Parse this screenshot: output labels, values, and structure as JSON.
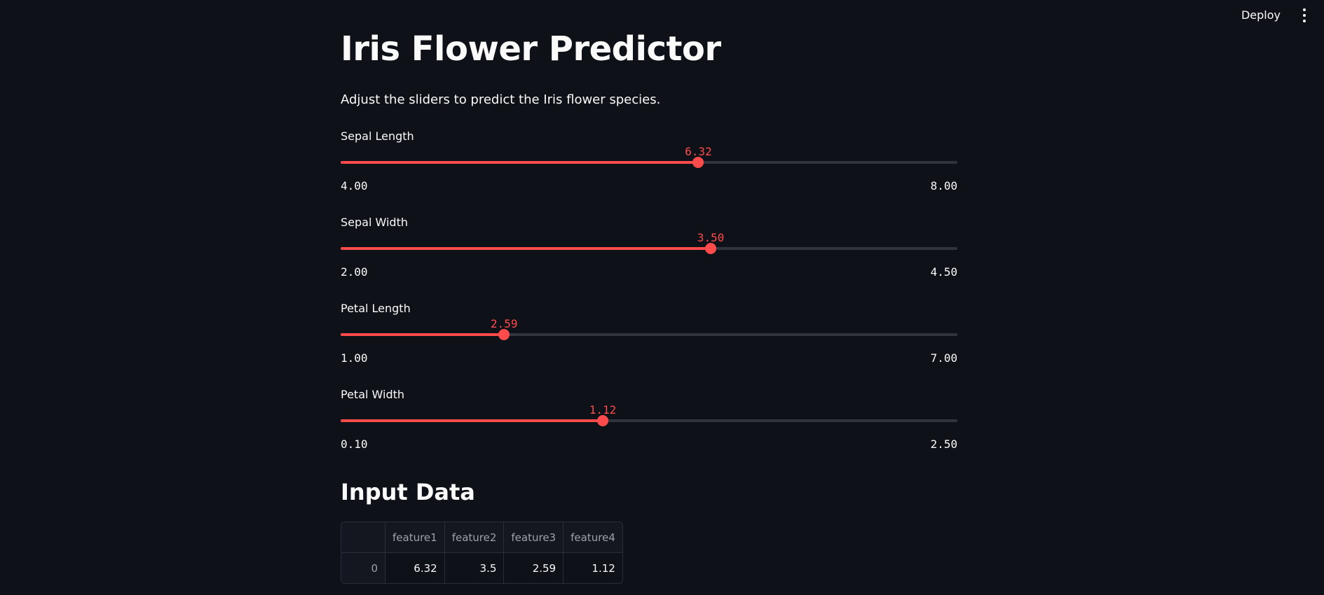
{
  "header": {
    "deploy_label": "Deploy",
    "menu_icon": "kebab-menu-icon"
  },
  "page": {
    "title": "Iris Flower Predictor",
    "subtitle": "Adjust the sliders to predict the Iris flower species."
  },
  "sliders": [
    {
      "label": "Sepal Length",
      "value": "6.32",
      "min": "4.00",
      "max": "8.00"
    },
    {
      "label": "Sepal Width",
      "value": "3.50",
      "min": "2.00",
      "max": "4.50"
    },
    {
      "label": "Petal Length",
      "value": "2.59",
      "min": "1.00",
      "max": "7.00"
    },
    {
      "label": "Petal Width",
      "value": "1.12",
      "min": "0.10",
      "max": "2.50"
    }
  ],
  "input_data": {
    "heading": "Input Data",
    "columns": [
      "",
      "feature1",
      "feature2",
      "feature3",
      "feature4"
    ],
    "rows": [
      [
        "0",
        "6.32",
        "3.5",
        "2.59",
        "1.12"
      ]
    ]
  },
  "colors": {
    "background": "#0e1117",
    "accent": "#ff4b4b",
    "track": "#31333d",
    "text": "#fafafa"
  }
}
